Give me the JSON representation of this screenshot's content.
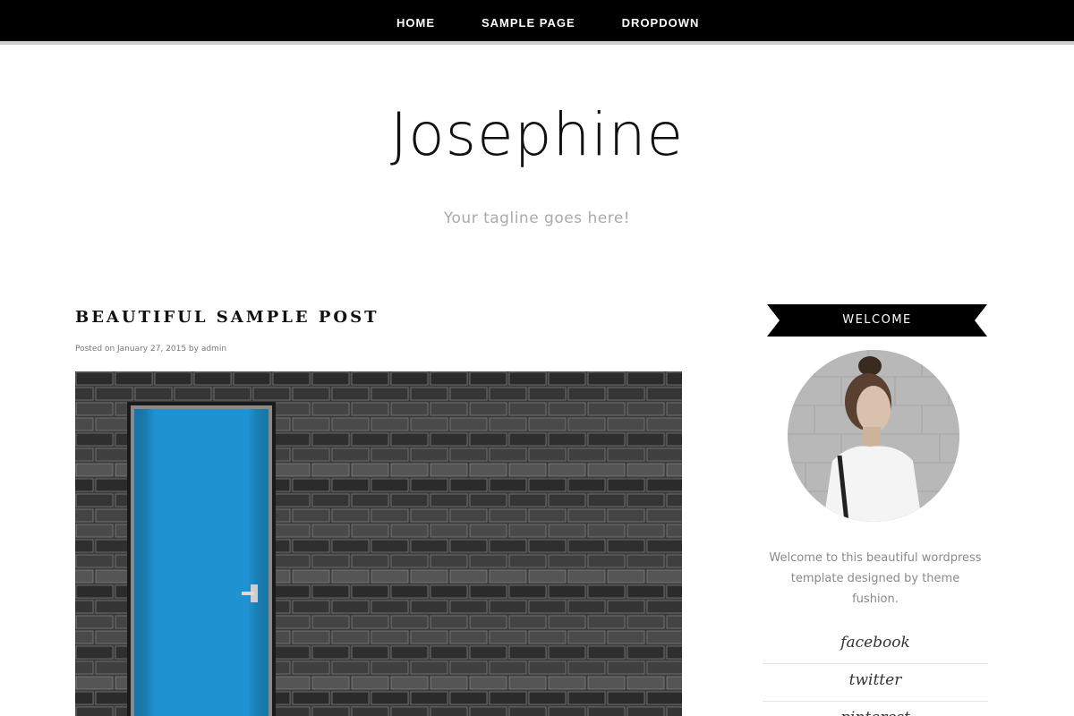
{
  "nav": {
    "items": [
      {
        "label": "HOME"
      },
      {
        "label": "SAMPLE PAGE"
      },
      {
        "label": "DROPDOWN"
      }
    ]
  },
  "header": {
    "site_title": "Josephine",
    "tagline": "Your tagline goes here!"
  },
  "post": {
    "title": "BEAUTIFUL SAMPLE POST",
    "meta": "Posted on January 27, 2015 by admin",
    "image_alt": "blue door in a grey brick wall",
    "door_color": "#1f93d1"
  },
  "sidebar": {
    "widget_title": "WELCOME",
    "welcome_text": "Welcome to this beautiful wordpress template designed by theme fushion.",
    "social": [
      {
        "label": "facebook"
      },
      {
        "label": "twitter"
      },
      {
        "label": "pinterest"
      }
    ]
  },
  "colors": {
    "nav_bg": "#000000",
    "ribbon_bg": "#000000",
    "tagline": "#aaaaaa"
  }
}
